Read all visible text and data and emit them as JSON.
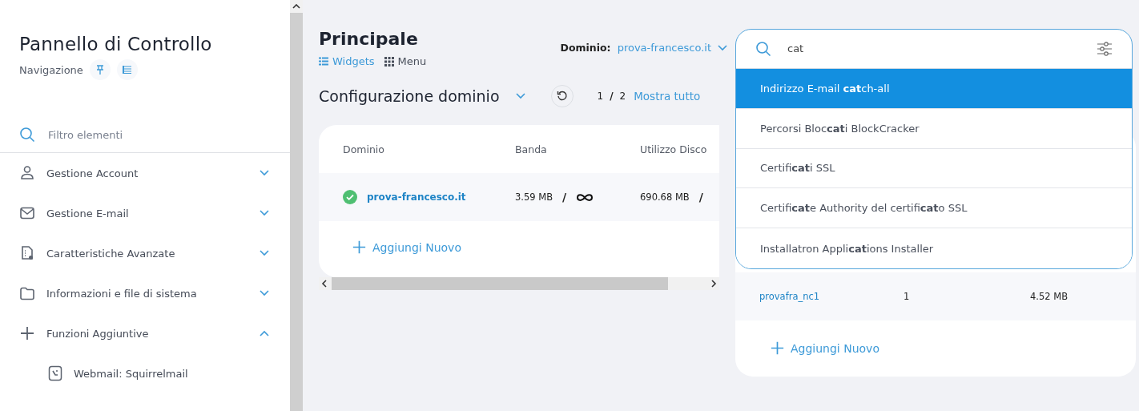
{
  "sidebar": {
    "title": "Pannello di Controllo",
    "subtitle": "Navigazione",
    "search": {
      "placeholder": "Filtro elementi"
    },
    "items": [
      {
        "label": "Gestione Account",
        "expanded": false
      },
      {
        "label": "Gestione E-mail",
        "expanded": false
      },
      {
        "label": "Caratteristiche Avanzate",
        "expanded": false
      },
      {
        "label": "Informazioni e file di sistema",
        "expanded": false
      },
      {
        "label": "Funzioni Aggiuntive",
        "expanded": true,
        "children": [
          {
            "label": "Webmail: Squirrelmail"
          }
        ]
      }
    ]
  },
  "main": {
    "title": "Principale",
    "views": [
      {
        "label": "Widgets",
        "selected": true
      },
      {
        "label": "Menu",
        "selected": false
      }
    ],
    "domain": {
      "label": "Dominio:",
      "value": "prova-francesco.it"
    },
    "section": {
      "title": "Configurazione dominio",
      "page": "1",
      "separator": "/",
      "total": "2",
      "show_all": "Mostra tutto"
    },
    "table": {
      "columns": [
        "Dominio",
        "Banda",
        "Utilizzo Disco"
      ],
      "rows": [
        {
          "domain": "prova-francesco.it",
          "active": true,
          "bandwidth": "3.59 MB",
          "bandwidth_separator": "/",
          "disk": "690.68 MB",
          "disk_separator": "/"
        }
      ],
      "add_new": "Aggiungi Nuovo"
    }
  },
  "search": {
    "value": "cat",
    "results": [
      {
        "label": "Indirizzo E-mail **cat**ch-all",
        "selected": true
      },
      {
        "label": "Percorsi Bloc**cat**i BlockCracker",
        "selected": false
      },
      {
        "label": "Certifi**cat**i SSL",
        "selected": false
      },
      {
        "label": "Certifi**cat**e Authority del certifi**cat**o SSL",
        "selected": false
      },
      {
        "label": "Installatron Appli**cat**ions Installer",
        "selected": false
      }
    ]
  },
  "side_table": {
    "rows": [
      {
        "column_1": "provafra_nc1",
        "column_2": "1",
        "column_3": "4.52 MB"
      }
    ],
    "add_new": "Aggiungi Nuovo"
  }
}
